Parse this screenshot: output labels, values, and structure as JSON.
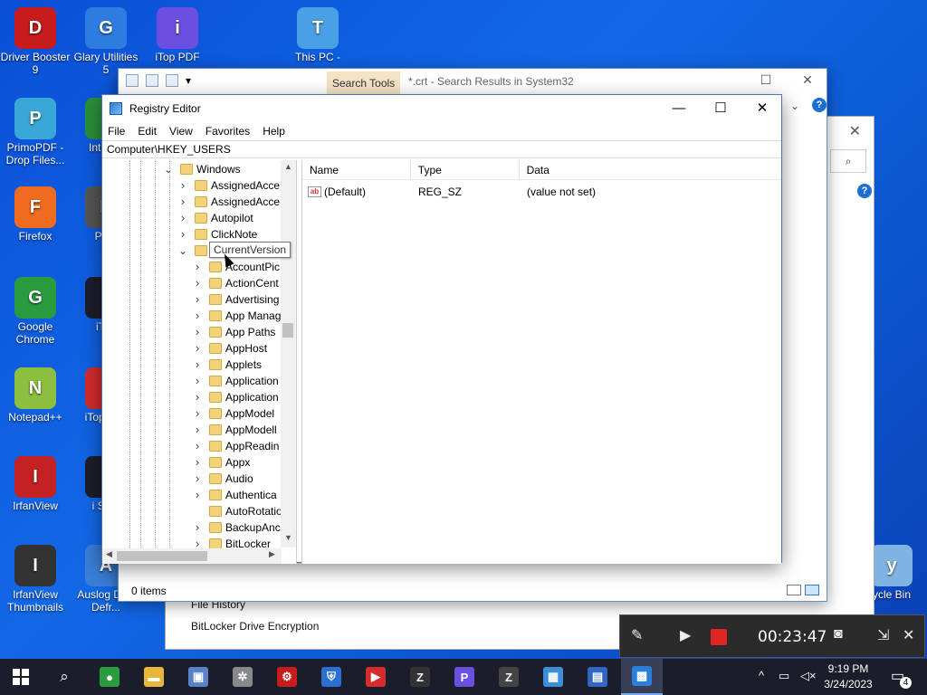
{
  "desktop_icons": [
    {
      "label": "Driver Booster 9",
      "icon": "driver-booster-icon",
      "color": "#c81c1c"
    },
    {
      "label": "Glary Utilities 5",
      "icon": "glary-utilities-icon",
      "color": "#2d7de0"
    },
    {
      "label": "iTop PDF",
      "icon": "itop-pdf-icon",
      "color": "#6a4fe0"
    },
    {
      "label": "This PC -",
      "icon": "this-pc-icon",
      "color": "#4aa0e6"
    },
    {
      "label": "PrimoPDF - Drop Files...",
      "icon": "primopdf-icon",
      "color": "#3aa7d9"
    },
    {
      "label": "Int Dov",
      "icon": "internet-download-icon",
      "color": "#2a8f3a"
    },
    {
      "label": "Firefox",
      "icon": "firefox-icon",
      "color": "#ef6b1f"
    },
    {
      "label": "Phot",
      "icon": "photo-app-icon",
      "color": "#555555"
    },
    {
      "label": "Google Chrome",
      "icon": "chrome-icon",
      "color": "#2a9b3f"
    },
    {
      "label": "iTop",
      "icon": "itop-screen-icon",
      "color": "#1c1c2c"
    },
    {
      "label": "Notepad++",
      "icon": "notepadpp-icon",
      "color": "#8cbf3f"
    },
    {
      "label": "iTop Rec",
      "icon": "itop-recorder-icon",
      "color": "#d22c2c"
    },
    {
      "label": "IrfanView",
      "icon": "irfanview-icon",
      "color": "#c42222"
    },
    {
      "label": "i Scre",
      "icon": "itop-screenshot-icon",
      "color": "#1e1e2c"
    },
    {
      "label": "IrfanView Thumbnails",
      "icon": "irfanview-thumbnails-icon",
      "color": "#333333"
    },
    {
      "label": "Auslog Disk Defr...",
      "icon": "auslogics-defrag-icon",
      "color": "#3a7ed8"
    },
    {
      "label": "ycle Bin",
      "icon": "recycle-bin-icon",
      "color": "#7fb4e2"
    }
  ],
  "explorer": {
    "search_tools_tab": "Search Tools",
    "title": "*.crt - Search Results in System32",
    "status": "0 items"
  },
  "settings": {
    "item_file_history": "File History",
    "item_bitlocker": "BitLocker Drive Encryption"
  },
  "regedit": {
    "title": "Registry Editor",
    "menu": [
      "File",
      "Edit",
      "View",
      "Favorites",
      "Help"
    ],
    "address": "Computer\\HKEY_USERS",
    "tooltip": "CurrentVersion",
    "tree": [
      {
        "label": "Windows",
        "level": 0,
        "expanded": true
      },
      {
        "label": "AssignedAcce",
        "level": 1
      },
      {
        "label": "AssignedAcce",
        "level": 1
      },
      {
        "label": "Autopilot",
        "level": 1
      },
      {
        "label": "ClickNote",
        "level": 1
      },
      {
        "label": "CurrentVersion",
        "level": 1,
        "expanded": true
      },
      {
        "label": "AccountPic",
        "level": 2
      },
      {
        "label": "ActionCent",
        "level": 2
      },
      {
        "label": "Advertising",
        "level": 2
      },
      {
        "label": "App Manag",
        "level": 2
      },
      {
        "label": "App Paths",
        "level": 2
      },
      {
        "label": "AppHost",
        "level": 2
      },
      {
        "label": "Applets",
        "level": 2
      },
      {
        "label": "Application",
        "level": 2
      },
      {
        "label": "Application",
        "level": 2
      },
      {
        "label": "AppModel",
        "level": 2
      },
      {
        "label": "AppModell",
        "level": 2
      },
      {
        "label": "AppReadin",
        "level": 2
      },
      {
        "label": "Appx",
        "level": 2
      },
      {
        "label": "Audio",
        "level": 2
      },
      {
        "label": "Authentica",
        "level": 2
      },
      {
        "label": "AutoRotatio",
        "level": 2,
        "nochev": true
      },
      {
        "label": "BackupAnc",
        "level": 2
      },
      {
        "label": "BitLocker",
        "level": 2
      }
    ],
    "columns": [
      "Name",
      "Type",
      "Data"
    ],
    "values": [
      {
        "name": "(Default)",
        "type": "REG_SZ",
        "data": "(value not set)"
      }
    ]
  },
  "recorder": {
    "time": "00:23:47"
  },
  "taskbar": {
    "apps": [
      {
        "name": "chrome",
        "color": "#2a9b3f",
        "glyph": "●"
      },
      {
        "name": "file-explorer",
        "color": "#e8b63a",
        "glyph": "▬"
      },
      {
        "name": "installer",
        "color": "#5a82c8",
        "glyph": "▣"
      },
      {
        "name": "app-spinner",
        "color": "#888888",
        "glyph": "✲"
      },
      {
        "name": "driver-booster",
        "color": "#c81c1c",
        "glyph": "⚙"
      },
      {
        "name": "security-shield",
        "color": "#2d6fd1",
        "glyph": "⛨"
      },
      {
        "name": "itop-recorder",
        "color": "#d22c2c",
        "glyph": "▶"
      },
      {
        "name": "winzip",
        "color": "#333333",
        "glyph": "Z"
      },
      {
        "name": "itop-pdf",
        "color": "#6a4fe0",
        "glyph": "P"
      },
      {
        "name": "zip-tool",
        "color": "#444444",
        "glyph": "Z"
      },
      {
        "name": "control-panel",
        "color": "#3a8fd8",
        "glyph": "▦"
      },
      {
        "name": "system-tool",
        "color": "#3166c6",
        "glyph": "▤"
      },
      {
        "name": "registry-editor",
        "color": "#2a7fd9",
        "glyph": "▩"
      }
    ],
    "time": "9:19 PM",
    "date": "3/24/2023",
    "notification_count": "4"
  }
}
